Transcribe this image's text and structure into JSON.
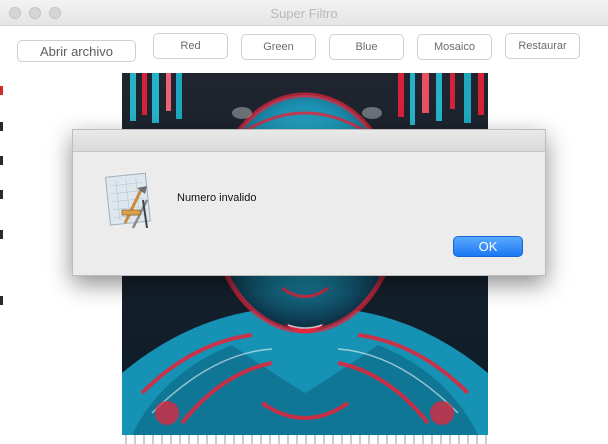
{
  "window": {
    "title": "Super Filtro"
  },
  "toolbar": {
    "open_label": "Abrir archivo",
    "red_label": "Red",
    "green_label": "Green",
    "blue_label": "Blue",
    "mosaic_label": "Mosaico",
    "restore_label": "Restaurar"
  },
  "alert": {
    "message": "Numero invalido",
    "ok_label": "OK",
    "icon": "xcode-app-icon"
  },
  "colors": {
    "accent": "#1a78f2",
    "photo_red": "#e8233a",
    "photo_cyan": "#1fb6cf"
  }
}
